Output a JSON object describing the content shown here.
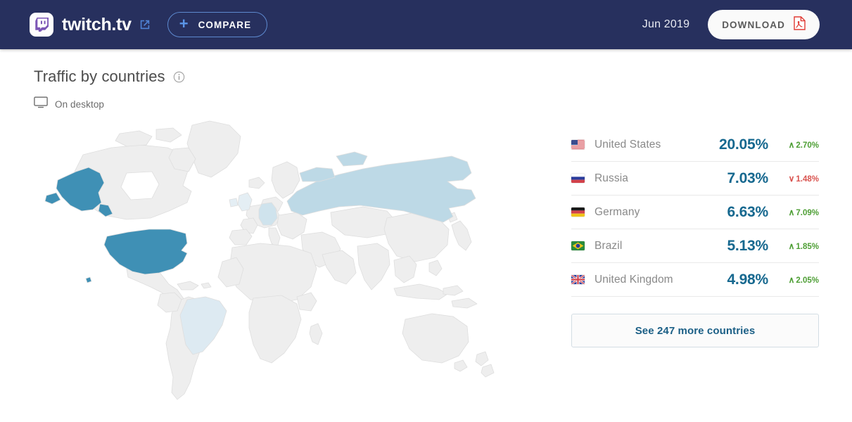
{
  "header": {
    "logo_icon": "twitch-glitch-icon",
    "site_name": "twitch.tv",
    "external_link_icon": "external-link-icon",
    "compare_plus_icon": "plus-icon",
    "compare_label": "COMPARE",
    "period": "Jun 2019",
    "download_label": "DOWNLOAD",
    "download_icon": "pdf-file-icon",
    "background_color": "#27305e",
    "accent_border_color": "#5d89cf"
  },
  "panel": {
    "title": "Traffic by countries",
    "info_icon": "info-circle-icon",
    "device_icon": "desktop-monitor-icon",
    "device_label": "On desktop",
    "see_more_label": "See 247 more countries"
  },
  "chart_data": {
    "type": "map",
    "title": "Traffic by countries",
    "subtitle": "On desktop",
    "period": "Jun 2019",
    "unit": "percent of traffic",
    "legend_position": "right-list",
    "highlight_colors": {
      "rank1": "#3f90b5",
      "rank2": "#bdd9e6",
      "rank3": "#cfe3ed",
      "rank4": "#ddeaf2",
      "rank5": "#e4eef4",
      "unhighlighted": "#eeeeee",
      "border": "#dedede"
    },
    "categories": [
      "United States",
      "Russia",
      "Germany",
      "Brazil",
      "United Kingdom"
    ],
    "values": [
      20.05,
      7.03,
      6.63,
      5.13,
      4.98
    ],
    "deltas": [
      2.7,
      -1.48,
      7.09,
      1.85,
      2.05
    ],
    "more_countries": 247
  },
  "countries": [
    {
      "flag": "flag-us",
      "name": "United States",
      "value": "20.05%",
      "delta": "2.70%",
      "direction": "up",
      "caret": "∧"
    },
    {
      "flag": "flag-ru",
      "name": "Russia",
      "value": "7.03%",
      "delta": "1.48%",
      "direction": "down",
      "caret": "∨"
    },
    {
      "flag": "flag-de",
      "name": "Germany",
      "value": "6.63%",
      "delta": "7.09%",
      "direction": "up",
      "caret": "∧"
    },
    {
      "flag": "flag-br",
      "name": "Brazil",
      "value": "5.13%",
      "delta": "1.85%",
      "direction": "up",
      "caret": "∧"
    },
    {
      "flag": "flag-gb",
      "name": "United Kingdom",
      "value": "4.98%",
      "delta": "2.05%",
      "direction": "up",
      "caret": "∧"
    }
  ]
}
